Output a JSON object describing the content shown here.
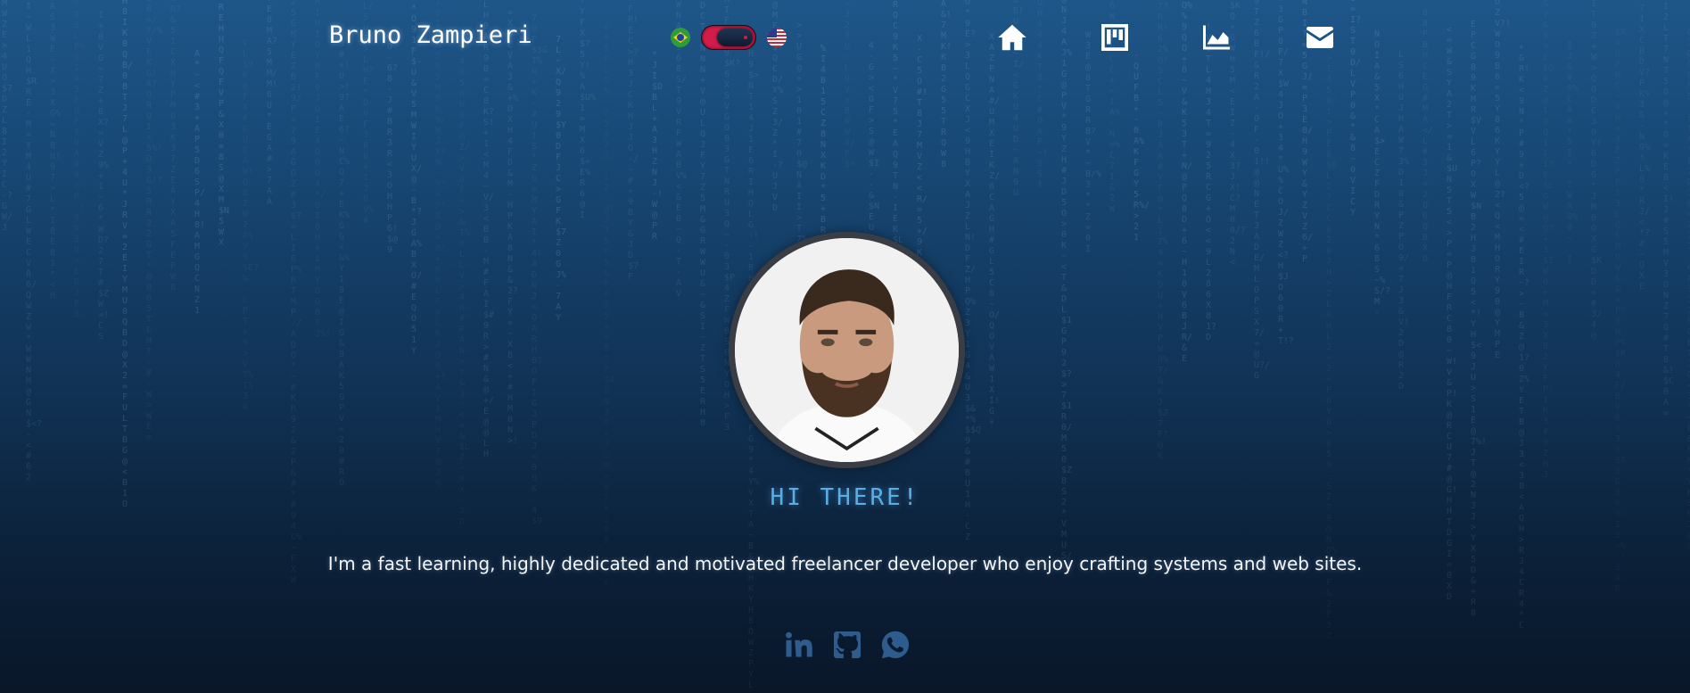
{
  "header": {
    "brand": "Bruno Zampieri",
    "language": {
      "left_flag": "brazil-flag-icon",
      "right_flag": "us-flag-icon",
      "toggle_color": "#d21c4a"
    },
    "nav": [
      {
        "name": "home",
        "icon": "home-icon"
      },
      {
        "name": "projects",
        "icon": "kanban-icon"
      },
      {
        "name": "stats",
        "icon": "area-chart-icon"
      },
      {
        "name": "contact",
        "icon": "envelope-icon"
      }
    ]
  },
  "hero": {
    "greeting": "HI THERE!",
    "bio": "I'm a fast learning, highly dedicated and motivated freelancer developer who enjoy crafting systems and web sites.",
    "accent_color": "#5aaee8"
  },
  "social": [
    {
      "name": "linkedin",
      "icon": "linkedin-icon"
    },
    {
      "name": "github",
      "icon": "github-icon"
    },
    {
      "name": "whatsapp",
      "icon": "whatsapp-icon"
    }
  ],
  "theme": {
    "background_top": "#1e5689",
    "background_bottom": "#0b1e33",
    "matrix_rain_color": "#7fa6cf"
  }
}
